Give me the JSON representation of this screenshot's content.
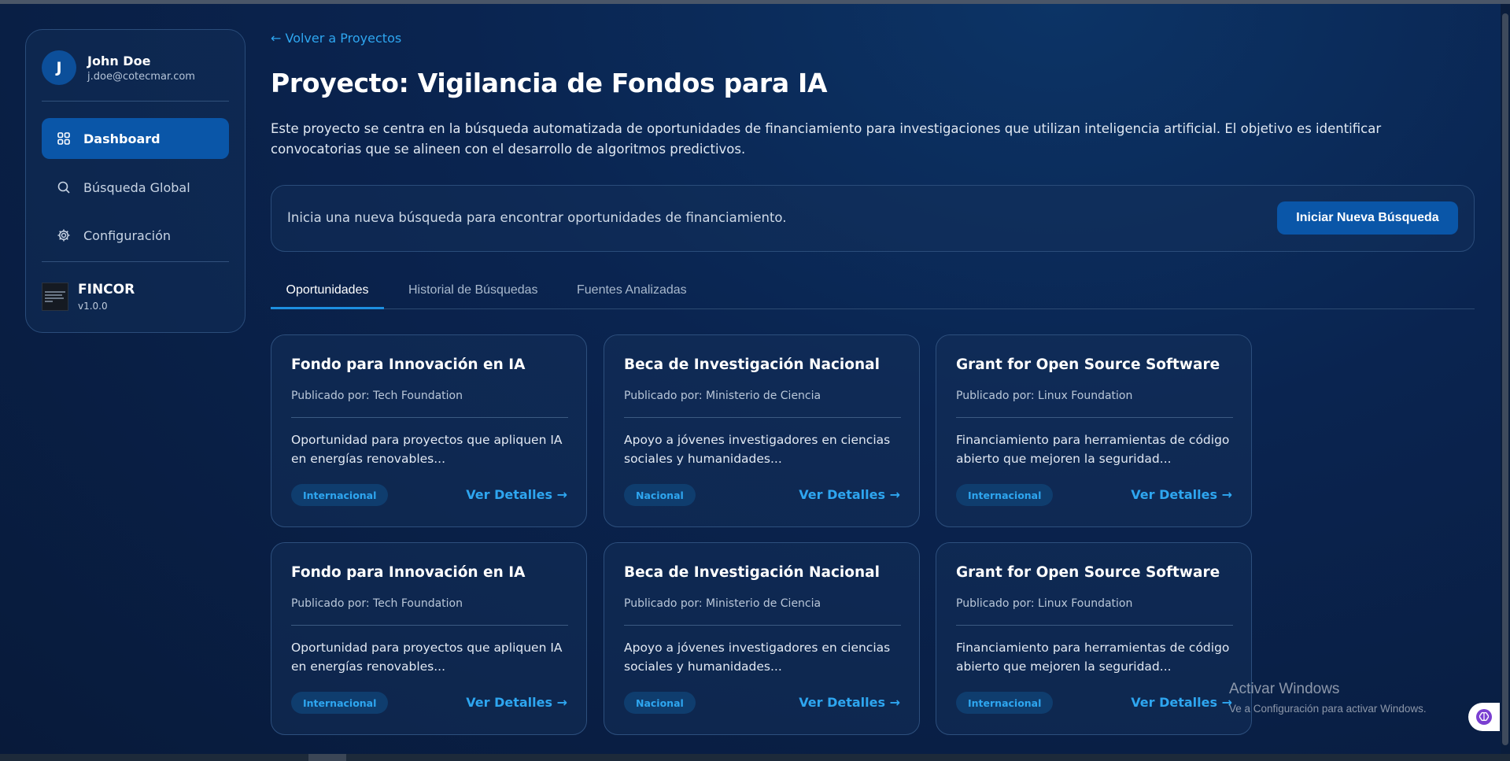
{
  "user": {
    "initial": "J",
    "name": "John Doe",
    "email": "j.doe@cotecmar.com"
  },
  "nav": [
    {
      "label": "Dashboard",
      "icon": "grid-icon",
      "active": true
    },
    {
      "label": "Búsqueda Global",
      "icon": "search-icon",
      "active": false
    },
    {
      "label": "Configuración",
      "icon": "gear-icon",
      "active": false
    }
  ],
  "brand": {
    "name": "FINCOR",
    "version": "v1.0.0"
  },
  "back_link": "← Volver a Proyectos",
  "page_title": "Proyecto: Vigilancia de Fondos para IA",
  "description": "Este proyecto se centra en la búsqueda automatizada de oportunidades de financiamiento para investigaciones que utilizan inteligencia artificial. El objetivo es identificar convocatorias que se alineen con el desarrollo de algoritmos predictivos.",
  "search_panel": {
    "text": "Inicia una nueva búsqueda para encontrar oportunidades de financiamiento.",
    "button_label": "Iniciar Nueva Búsqueda"
  },
  "tabs": [
    {
      "label": "Oportunidades",
      "active": true
    },
    {
      "label": "Historial de Búsquedas",
      "active": false
    },
    {
      "label": "Fuentes Analizadas",
      "active": false
    }
  ],
  "cards": [
    {
      "title": "Fondo para Innovación en IA",
      "publisher": "Publicado por: Tech Foundation",
      "description": "Oportunidad para proyectos que apliquen IA en energías renovables...",
      "badge": "Internacional",
      "link": "Ver Detalles →"
    },
    {
      "title": "Beca de Investigación Nacional",
      "publisher": "Publicado por: Ministerio de Ciencia",
      "description": "Apoyo a jóvenes investigadores en ciencias sociales y humanidades...",
      "badge": "Nacional",
      "link": "Ver Detalles →"
    },
    {
      "title": "Grant for Open Source Software",
      "publisher": "Publicado por: Linux Foundation",
      "description": "Financiamiento para herramientas de código abierto que mejoren la seguridad...",
      "badge": "Internacional",
      "link": "Ver Detalles →"
    },
    {
      "title": "Fondo para Innovación en IA",
      "publisher": "Publicado por: Tech Foundation",
      "description": "Oportunidad para proyectos que apliquen IA en energías renovables...",
      "badge": "Internacional",
      "link": "Ver Detalles →"
    },
    {
      "title": "Beca de Investigación Nacional",
      "publisher": "Publicado por: Ministerio de Ciencia",
      "description": "Apoyo a jóvenes investigadores en ciencias sociales y humanidades...",
      "badge": "Nacional",
      "link": "Ver Detalles →"
    },
    {
      "title": "Grant for Open Source Software",
      "publisher": "Publicado por: Linux Foundation",
      "description": "Financiamiento para herramientas de código abierto que mejoren la seguridad...",
      "badge": "Internacional",
      "link": "Ver Detalles →"
    }
  ],
  "watermark": {
    "title": "Activar Windows",
    "subtitle": "Ve a Configuración para activar Windows."
  },
  "colors": {
    "accent": "#0a56a8",
    "link": "#2ea6f0",
    "background": "#0a2450"
  }
}
